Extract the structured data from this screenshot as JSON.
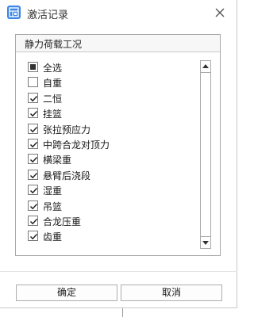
{
  "window": {
    "title": "激活记录",
    "app_icon": "chart-table-icon",
    "close_icon": "close-icon",
    "accent_color": "#3a86e8"
  },
  "group": {
    "title": "静力荷载工况",
    "items": [
      {
        "label": "全选",
        "state": "partial"
      },
      {
        "label": "自重",
        "state": "unchecked"
      },
      {
        "label": "二恒",
        "state": "checked"
      },
      {
        "label": "挂篮",
        "state": "checked"
      },
      {
        "label": "张拉预应力",
        "state": "checked"
      },
      {
        "label": "中跨合龙对顶力",
        "state": "checked"
      },
      {
        "label": "横梁重",
        "state": "checked"
      },
      {
        "label": "悬臂后浇段",
        "state": "checked"
      },
      {
        "label": "湿重",
        "state": "checked"
      },
      {
        "label": "吊篮",
        "state": "checked"
      },
      {
        "label": "合龙压重",
        "state": "checked"
      },
      {
        "label": "齿重",
        "state": "checked"
      }
    ]
  },
  "buttons": {
    "ok_label": "确定",
    "cancel_label": "取消"
  }
}
